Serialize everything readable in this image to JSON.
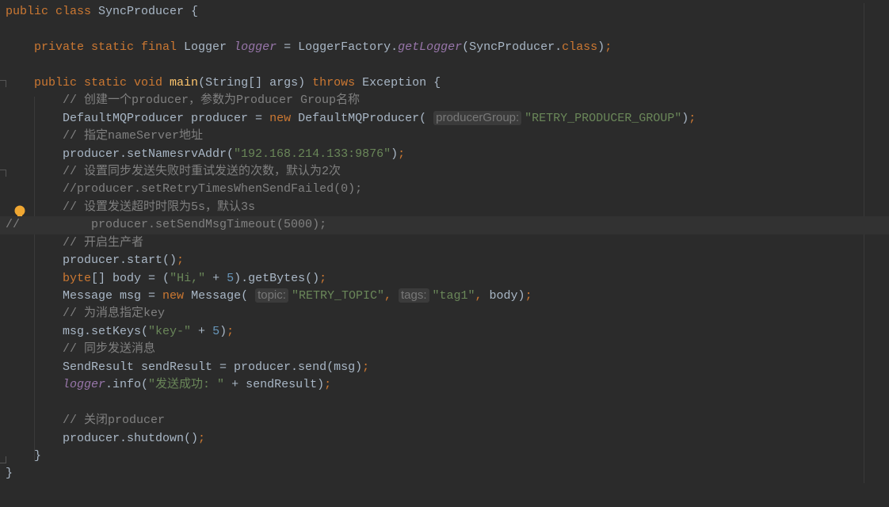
{
  "editor": {
    "colors": {
      "background": "#2b2b2b",
      "keyword": "#cc7832",
      "text": "#a9b7c6",
      "string": "#6a8759",
      "number": "#6897bb",
      "comment": "#808080",
      "method_declaration": "#ffc66d",
      "static_field": "#9876aa"
    },
    "current_line_index": 12,
    "lines": [
      {
        "tokens": [
          {
            "t": "kw",
            "s": "public class "
          },
          {
            "t": "tx",
            "s": "SyncProducer {"
          }
        ]
      },
      {
        "tokens": []
      },
      {
        "tokens": [
          {
            "t": "tx",
            "s": "    "
          },
          {
            "t": "kw",
            "s": "private static final "
          },
          {
            "t": "tx",
            "s": "Logger "
          },
          {
            "t": "sf",
            "s": "logger"
          },
          {
            "t": "tx",
            "s": " = LoggerFactory."
          },
          {
            "t": "sf",
            "s": "getLogger"
          },
          {
            "t": "tx",
            "s": "(SyncProducer."
          },
          {
            "t": "kw",
            "s": "class"
          },
          {
            "t": "tx",
            "s": ")"
          },
          {
            "t": "kw",
            "s": ";"
          }
        ]
      },
      {
        "tokens": []
      },
      {
        "tokens": [
          {
            "t": "tx",
            "s": "    "
          },
          {
            "t": "kw",
            "s": "public static void "
          },
          {
            "t": "md",
            "s": "main"
          },
          {
            "t": "tx",
            "s": "(String[] args) "
          },
          {
            "t": "kw",
            "s": "throws "
          },
          {
            "t": "tx",
            "s": "Exception {"
          }
        ]
      },
      {
        "tokens": [
          {
            "t": "cm",
            "s": "        // 创建一个producer，参数为Producer Group名称"
          }
        ]
      },
      {
        "tokens": [
          {
            "t": "tx",
            "s": "        DefaultMQProducer producer = "
          },
          {
            "t": "kw",
            "s": "new "
          },
          {
            "t": "tx",
            "s": "DefaultMQProducer( "
          },
          {
            "t": "hint",
            "s": "producerGroup:"
          },
          {
            "t": "st",
            "s": "\"RETRY_PRODUCER_GROUP\""
          },
          {
            "t": "tx",
            "s": ")"
          },
          {
            "t": "kw",
            "s": ";"
          }
        ]
      },
      {
        "tokens": [
          {
            "t": "cm",
            "s": "        // 指定nameServer地址"
          }
        ]
      },
      {
        "tokens": [
          {
            "t": "tx",
            "s": "        producer.setNamesrvAddr("
          },
          {
            "t": "st",
            "s": "\"192.168.214.133:9876\""
          },
          {
            "t": "tx",
            "s": ")"
          },
          {
            "t": "kw",
            "s": ";"
          }
        ]
      },
      {
        "tokens": [
          {
            "t": "cm",
            "s": "        // 设置同步发送失败时重试发送的次数，默认为2次"
          }
        ]
      },
      {
        "tokens": [
          {
            "t": "cm",
            "s": "        //producer.setRetryTimesWhenSendFailed(0);"
          }
        ]
      },
      {
        "tokens": [
          {
            "t": "cm",
            "s": "        // 设置发送超时时限为5s，默认3s"
          }
        ]
      },
      {
        "tokens": [
          {
            "t": "cm",
            "s": "//          producer.setSendMsgTimeout(5000);"
          }
        ]
      },
      {
        "tokens": [
          {
            "t": "cm",
            "s": "        // 开启生产者"
          }
        ]
      },
      {
        "tokens": [
          {
            "t": "tx",
            "s": "        producer.start()"
          },
          {
            "t": "kw",
            "s": ";"
          }
        ]
      },
      {
        "tokens": [
          {
            "t": "tx",
            "s": "        "
          },
          {
            "t": "kw",
            "s": "byte"
          },
          {
            "t": "tx",
            "s": "[] body = ("
          },
          {
            "t": "st",
            "s": "\"Hi,\""
          },
          {
            "t": "tx",
            "s": " + "
          },
          {
            "t": "nu",
            "s": "5"
          },
          {
            "t": "tx",
            "s": ").getBytes()"
          },
          {
            "t": "kw",
            "s": ";"
          }
        ]
      },
      {
        "tokens": [
          {
            "t": "tx",
            "s": "        Message msg = "
          },
          {
            "t": "kw",
            "s": "new "
          },
          {
            "t": "tx",
            "s": "Message( "
          },
          {
            "t": "hint",
            "s": "topic:"
          },
          {
            "t": "st",
            "s": "\"RETRY_TOPIC\""
          },
          {
            "t": "kw",
            "s": ", "
          },
          {
            "t": "hint",
            "s": "tags:"
          },
          {
            "t": "st",
            "s": "\"tag1\""
          },
          {
            "t": "kw",
            "s": ", "
          },
          {
            "t": "tx",
            "s": "body)"
          },
          {
            "t": "kw",
            "s": ";"
          }
        ]
      },
      {
        "tokens": [
          {
            "t": "cm",
            "s": "        // 为消息指定key"
          }
        ]
      },
      {
        "tokens": [
          {
            "t": "tx",
            "s": "        msg.setKeys("
          },
          {
            "t": "st",
            "s": "\"key-\""
          },
          {
            "t": "tx",
            "s": " + "
          },
          {
            "t": "nu",
            "s": "5"
          },
          {
            "t": "tx",
            "s": ")"
          },
          {
            "t": "kw",
            "s": ";"
          }
        ]
      },
      {
        "tokens": [
          {
            "t": "cm",
            "s": "        // 同步发送消息"
          }
        ]
      },
      {
        "tokens": [
          {
            "t": "tx",
            "s": "        SendResult sendResult = producer.send(msg)"
          },
          {
            "t": "kw",
            "s": ";"
          }
        ]
      },
      {
        "tokens": [
          {
            "t": "tx",
            "s": "        "
          },
          {
            "t": "sf",
            "s": "logger"
          },
          {
            "t": "tx",
            "s": ".info("
          },
          {
            "t": "st",
            "s": "\"发送成功: \""
          },
          {
            "t": "tx",
            "s": " + sendResult)"
          },
          {
            "t": "kw",
            "s": ";"
          }
        ]
      },
      {
        "tokens": []
      },
      {
        "tokens": [
          {
            "t": "cm",
            "s": "        // 关闭producer"
          }
        ]
      },
      {
        "tokens": [
          {
            "t": "tx",
            "s": "        producer.shutdown()"
          },
          {
            "t": "kw",
            "s": ";"
          }
        ]
      },
      {
        "tokens": [
          {
            "t": "tx",
            "s": "    }"
          }
        ]
      },
      {
        "tokens": [
          {
            "t": "tx",
            "s": "}"
          }
        ]
      }
    ],
    "gutter_icons": {
      "intention": "lightbulb-icon",
      "fold": "fold-marker-icon"
    }
  }
}
